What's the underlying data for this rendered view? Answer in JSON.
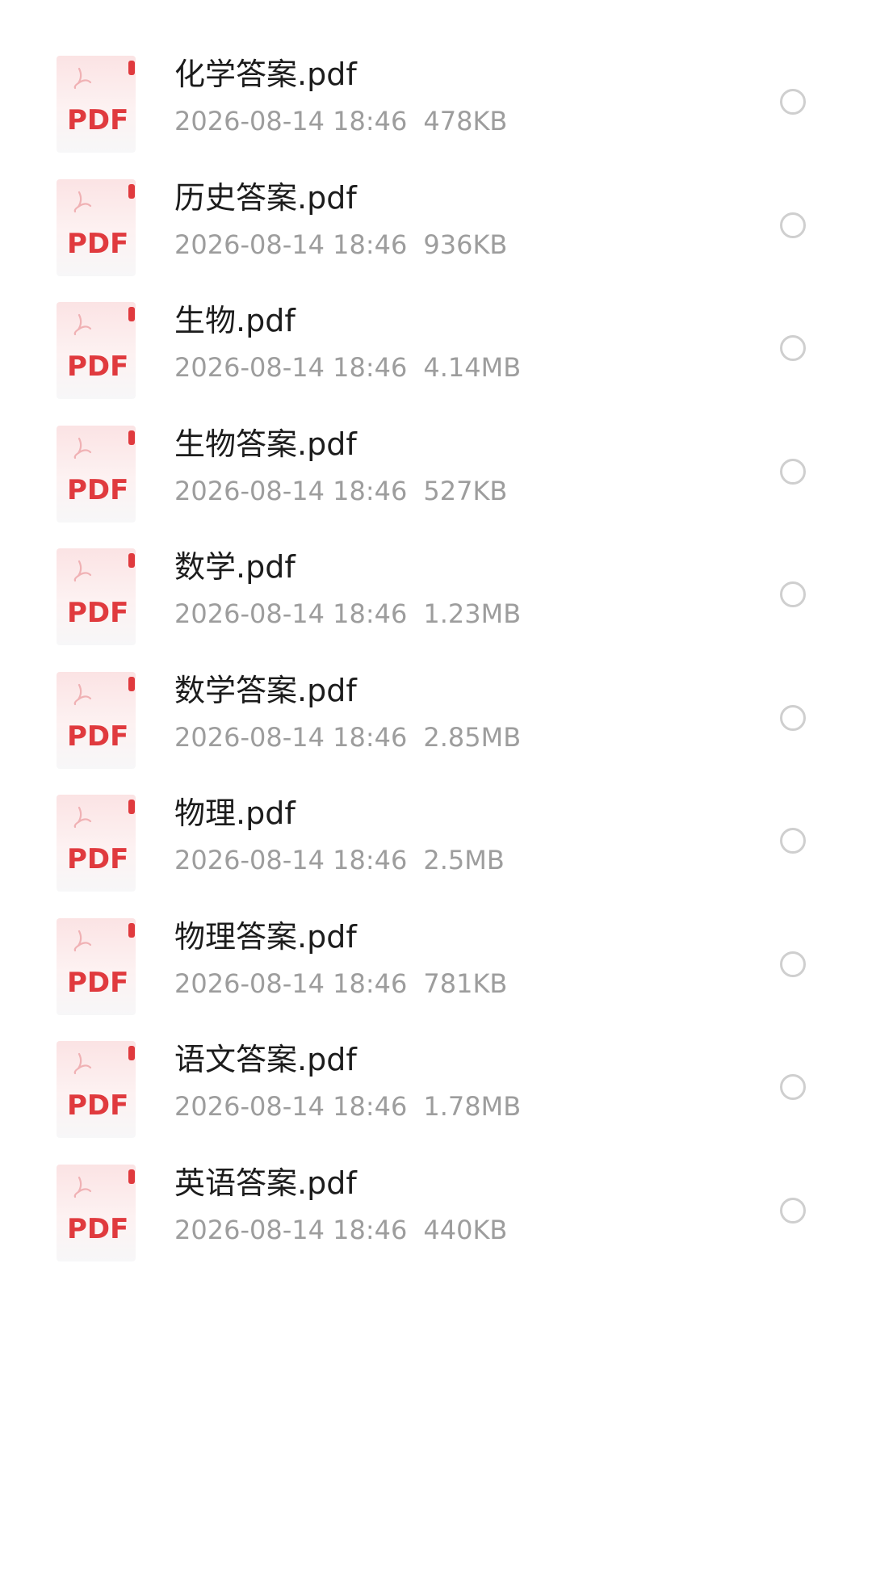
{
  "icon": "pdf-file-icon",
  "icon_label": "PDF",
  "colors": {
    "pdf_red": "#e03a3e",
    "text_primary": "#1c1c1c",
    "text_secondary": "#9d9d9d",
    "radio_border": "#cfcfcf"
  },
  "files": [
    {
      "name": "化学答案.pdf",
      "date": "2026-08-14 18:46",
      "size": "478KB",
      "selected": false
    },
    {
      "name": "历史答案.pdf",
      "date": "2026-08-14 18:46",
      "size": "936KB",
      "selected": false
    },
    {
      "name": "生物.pdf",
      "date": "2026-08-14 18:46",
      "size": "4.14MB",
      "selected": false
    },
    {
      "name": "生物答案.pdf",
      "date": "2026-08-14 18:46",
      "size": "527KB",
      "selected": false
    },
    {
      "name": "数学.pdf",
      "date": "2026-08-14 18:46",
      "size": "1.23MB",
      "selected": false
    },
    {
      "name": "数学答案.pdf",
      "date": "2026-08-14 18:46",
      "size": "2.85MB",
      "selected": false
    },
    {
      "name": "物理.pdf",
      "date": "2026-08-14 18:46",
      "size": "2.5MB",
      "selected": false
    },
    {
      "name": "物理答案.pdf",
      "date": "2026-08-14 18:46",
      "size": "781KB",
      "selected": false
    },
    {
      "name": "语文答案.pdf",
      "date": "2026-08-14 18:46",
      "size": "1.78MB",
      "selected": false
    },
    {
      "name": "英语答案.pdf",
      "date": "2026-08-14 18:46",
      "size": "440KB",
      "selected": false
    }
  ]
}
